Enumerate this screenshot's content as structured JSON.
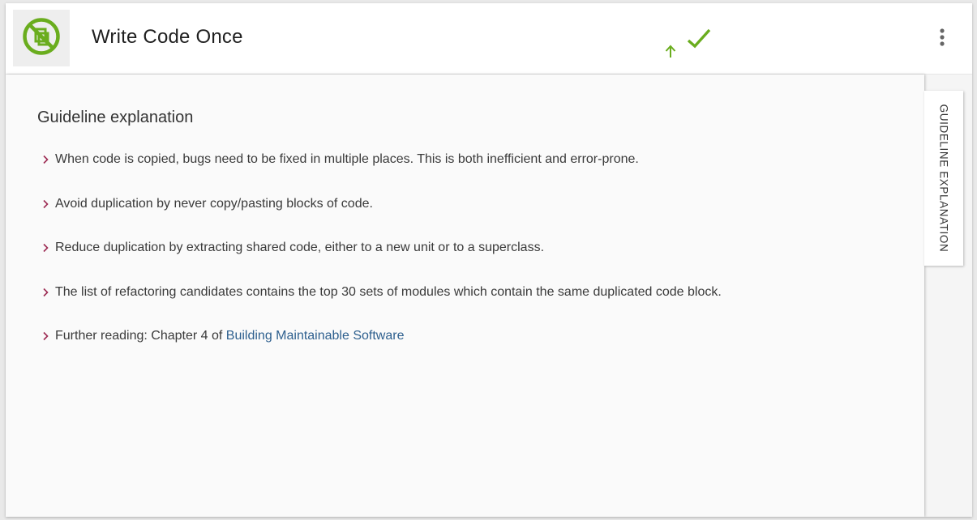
{
  "header": {
    "title": "Write Code Once",
    "logo_icon": "no-duplication-icon",
    "status_icons": [
      "arrow-up-icon",
      "checkmark-icon"
    ],
    "menu_icon": "more-vert-icon"
  },
  "panel": {
    "heading": "Guideline explanation",
    "bullets": [
      "When code is copied, bugs need to be fixed in multiple places. This is both inefficient and error-prone.",
      "Avoid duplication by never copy/pasting blocks of code.",
      "Reduce duplication by extracting shared code, either to a new unit or to a superclass.",
      "The list of refactoring candidates contains the top 30 sets of modules which contain the same duplicated code block."
    ],
    "further_reading": {
      "prefix": "Further reading: Chapter 4 of ",
      "link_text": "Building Maintainable Software"
    }
  },
  "side_tab": {
    "label": "GUIDELINE EXPLANATION"
  },
  "colors": {
    "accent_green": "#6aad1e",
    "chevron": "#9c2a52",
    "link": "#2d5f8e"
  }
}
